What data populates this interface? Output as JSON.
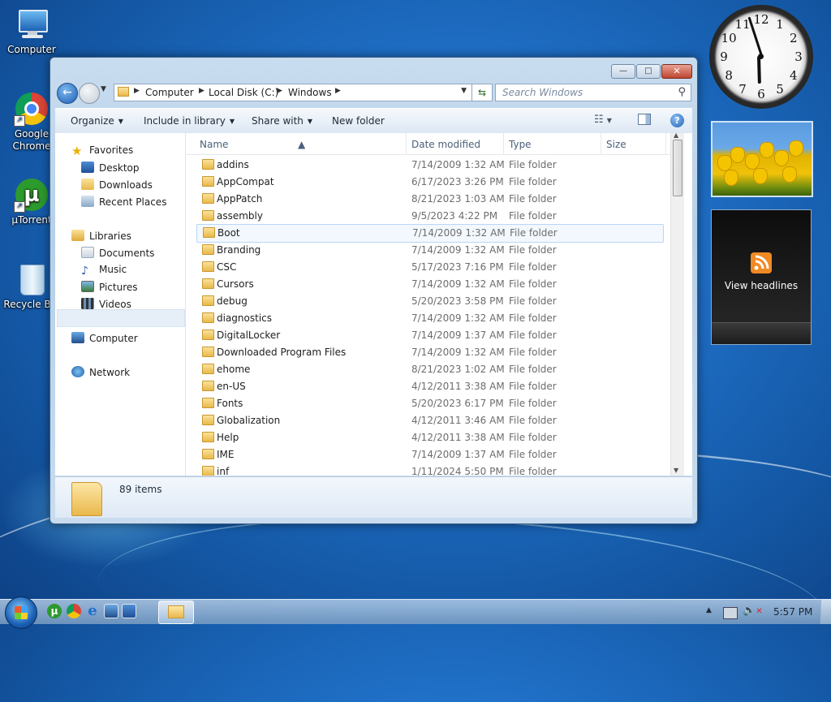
{
  "desktop": {
    "icons": [
      {
        "label": "Computer",
        "icon": "computer-icon"
      },
      {
        "label": "Google Chrome",
        "icon": "chrome-icon"
      },
      {
        "label": "µTorrent",
        "icon": "utorrent-icon"
      },
      {
        "label": "Recycle Bin",
        "icon": "recycle-bin-icon"
      }
    ]
  },
  "gadgets": {
    "clock": {
      "numerals": [
        "12",
        "1",
        "2",
        "3",
        "4",
        "5",
        "6",
        "7",
        "8",
        "9",
        "10",
        "11"
      ],
      "hour": 5,
      "minute": 57
    },
    "feed": {
      "label": "View headlines"
    }
  },
  "window": {
    "controls": {
      "minimize": "—",
      "maximize": "□",
      "close": "✕"
    },
    "address": {
      "crumbs": [
        "Computer",
        "Local Disk (C:)",
        "Windows"
      ]
    },
    "search": {
      "placeholder": "Search Windows"
    },
    "toolbar": {
      "organize": "Organize",
      "include": "Include in library",
      "share": "Share with",
      "new_folder": "New folder"
    },
    "nav": {
      "favorites": "Favorites",
      "desktop": "Desktop",
      "downloads": "Downloads",
      "recent": "Recent Places",
      "libraries": "Libraries",
      "documents": "Documents",
      "music": "Music",
      "pictures": "Pictures",
      "videos": "Videos",
      "computer": "Computer",
      "network": "Network"
    },
    "columns": {
      "name": "Name",
      "date": "Date modified",
      "type": "Type",
      "size": "Size"
    },
    "files": [
      {
        "name": "addins",
        "date": "7/14/2009 1:32 AM",
        "type": "File folder"
      },
      {
        "name": "AppCompat",
        "date": "6/17/2023 3:26 PM",
        "type": "File folder"
      },
      {
        "name": "AppPatch",
        "date": "8/21/2023 1:03 AM",
        "type": "File folder"
      },
      {
        "name": "assembly",
        "date": "9/5/2023 4:22 PM",
        "type": "File folder"
      },
      {
        "name": "Boot",
        "date": "7/14/2009 1:32 AM",
        "type": "File folder"
      },
      {
        "name": "Branding",
        "date": "7/14/2009 1:32 AM",
        "type": "File folder"
      },
      {
        "name": "CSC",
        "date": "5/17/2023 7:16 PM",
        "type": "File folder"
      },
      {
        "name": "Cursors",
        "date": "7/14/2009 1:32 AM",
        "type": "File folder"
      },
      {
        "name": "debug",
        "date": "5/20/2023 3:58 PM",
        "type": "File folder"
      },
      {
        "name": "diagnostics",
        "date": "7/14/2009 1:32 AM",
        "type": "File folder"
      },
      {
        "name": "DigitalLocker",
        "date": "7/14/2009 1:37 AM",
        "type": "File folder"
      },
      {
        "name": "Downloaded Program Files",
        "date": "7/14/2009 1:32 AM",
        "type": "File folder"
      },
      {
        "name": "ehome",
        "date": "8/21/2023 1:02 AM",
        "type": "File folder"
      },
      {
        "name": "en-US",
        "date": "4/12/2011 3:38 AM",
        "type": "File folder"
      },
      {
        "name": "Fonts",
        "date": "5/20/2023 6:17 PM",
        "type": "File folder"
      },
      {
        "name": "Globalization",
        "date": "4/12/2011 3:46 AM",
        "type": "File folder"
      },
      {
        "name": "Help",
        "date": "4/12/2011 3:38 AM",
        "type": "File folder"
      },
      {
        "name": "IME",
        "date": "7/14/2009 1:37 AM",
        "type": "File folder"
      },
      {
        "name": "inf",
        "date": "1/11/2024 5:50 PM",
        "type": "File folder"
      }
    ],
    "status": {
      "count": "89 items"
    }
  },
  "taskbar": {
    "time": "5:57 PM"
  }
}
